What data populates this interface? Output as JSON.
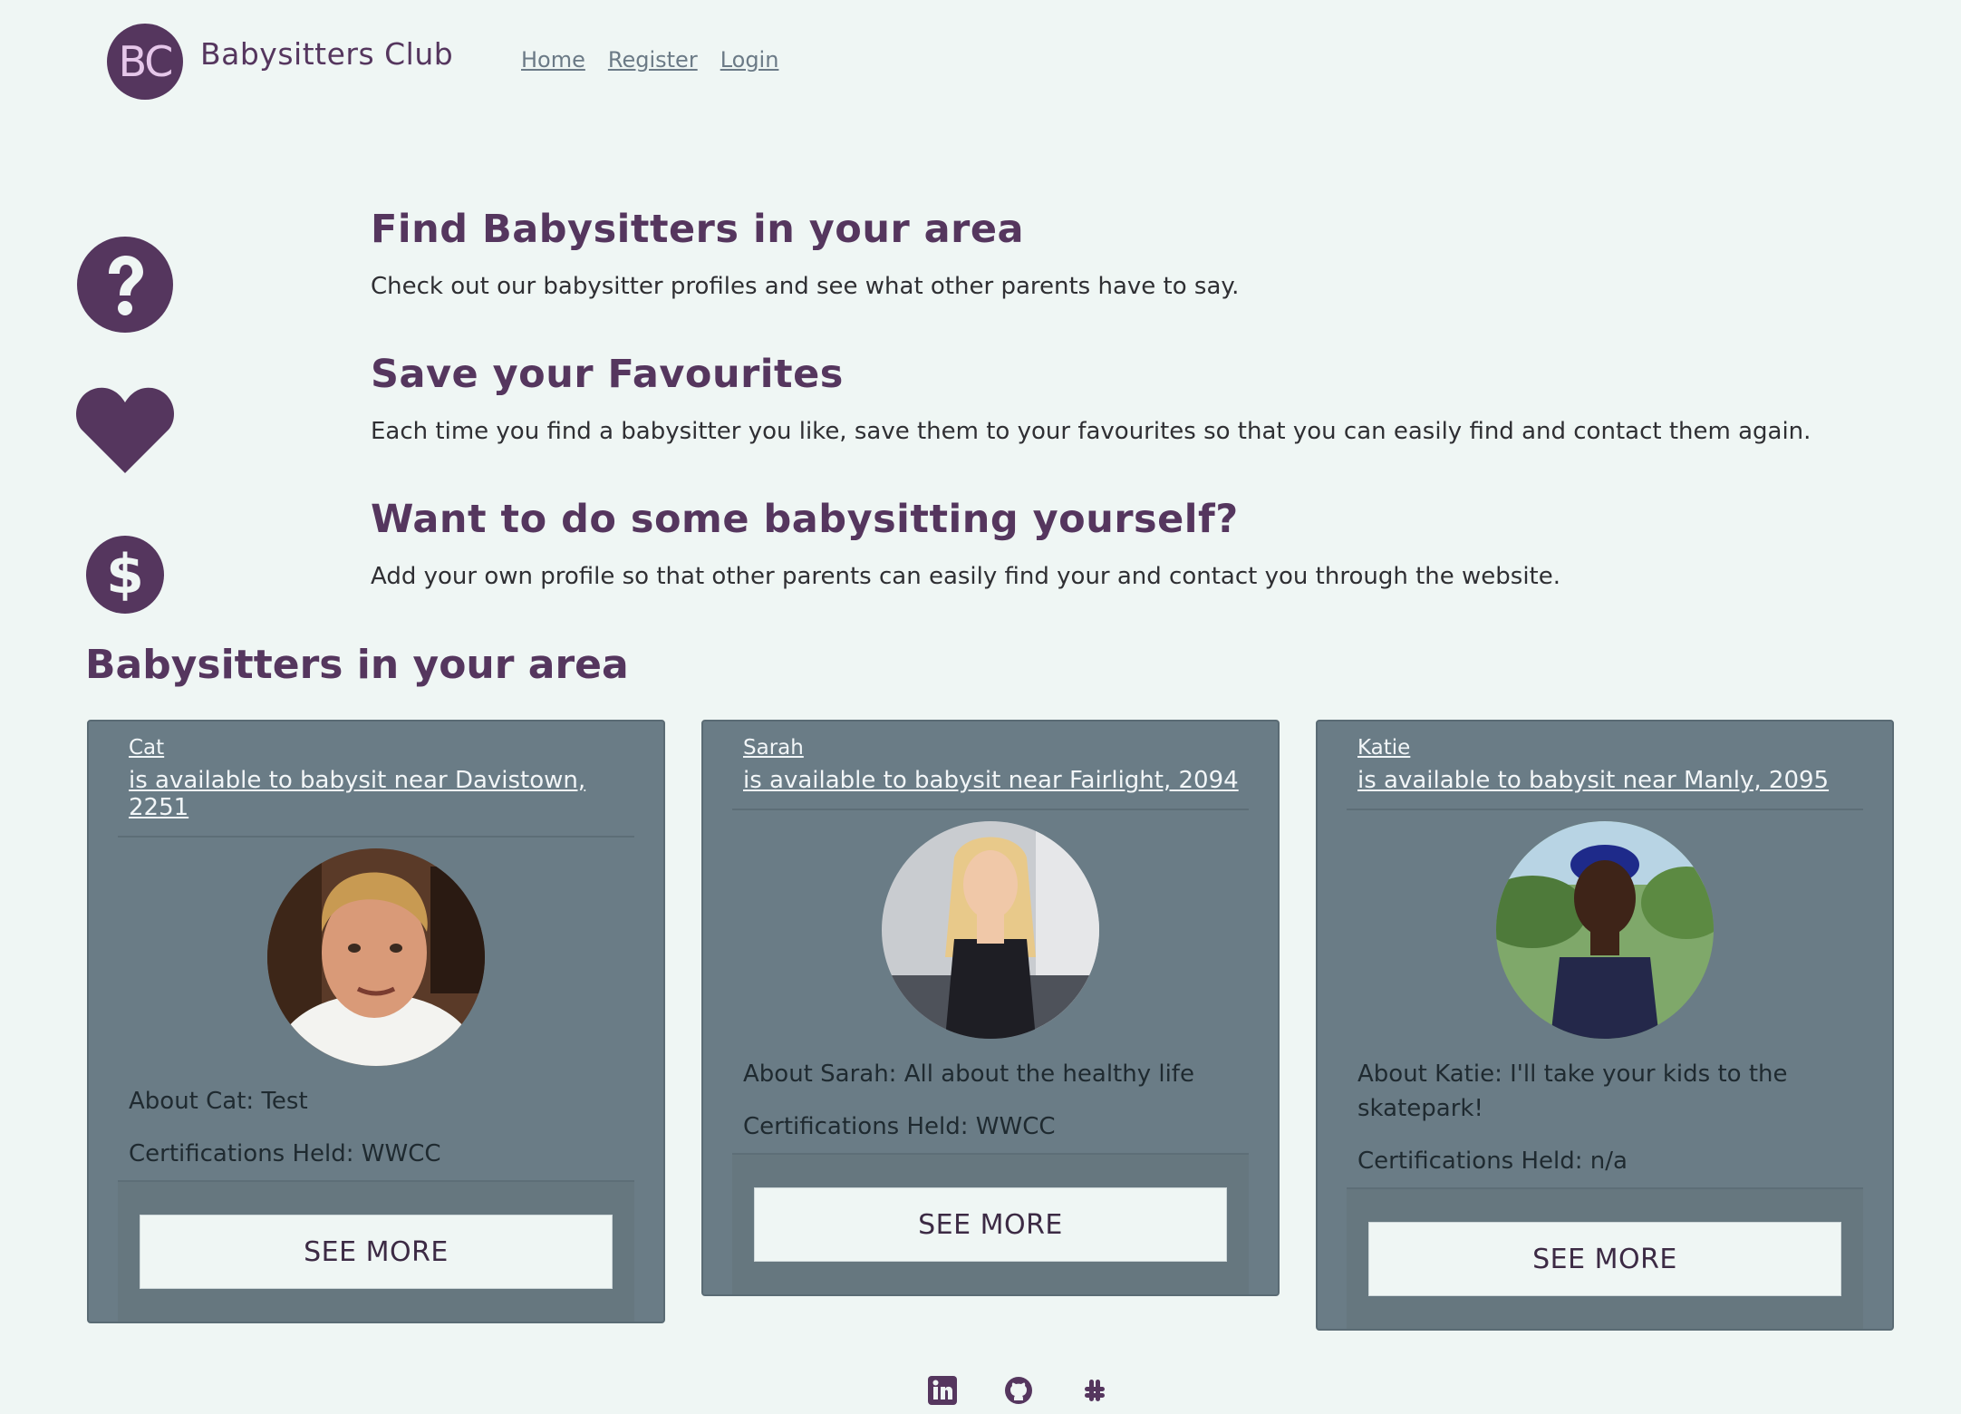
{
  "header": {
    "logo_text": "BC",
    "brand": "Babysitters Club",
    "nav": [
      {
        "label": "Home"
      },
      {
        "label": "Register"
      },
      {
        "label": "Login"
      }
    ]
  },
  "features": [
    {
      "icon": "question-icon",
      "title": "Find Babysitters in your area",
      "desc": "Check out our babysitter profiles and see what other parents have to say."
    },
    {
      "icon": "heart-icon",
      "title": "Save your Favourites",
      "desc": "Each time you find a babysitter you like, save them to your favourites so that you can easily find and contact them again."
    },
    {
      "icon": "dollar-icon",
      "title": "Want to do some babysitting yourself?",
      "desc": "Add your own profile so that other parents can easily find your and contact you through the website."
    }
  ],
  "section_title": "Babysitters in your area",
  "cards": [
    {
      "name": "Cat",
      "location": "is available to babysit near Davistown, 2251",
      "about": "About Cat: Test",
      "cert": "Certifications Held: WWCC",
      "button": "SEE MORE"
    },
    {
      "name": "Sarah",
      "location": "is available to babysit near Fairlight, 2094",
      "about": "About Sarah: All about the healthy life",
      "cert": "Certifications Held: WWCC",
      "button": "SEE MORE"
    },
    {
      "name": "Katie",
      "location": "is available to babysit near Manly, 2095",
      "about": "About Katie: I'll take your kids to the skatepark!",
      "cert": "Certifications Held: n/a",
      "button": "SEE MORE"
    }
  ],
  "footer": {
    "icons": [
      "linkedin-icon",
      "github-icon",
      "slack-icon"
    ]
  },
  "colors": {
    "background": "#eff6f4",
    "brand_purple": "#55365e",
    "card": "#6a7c86"
  }
}
